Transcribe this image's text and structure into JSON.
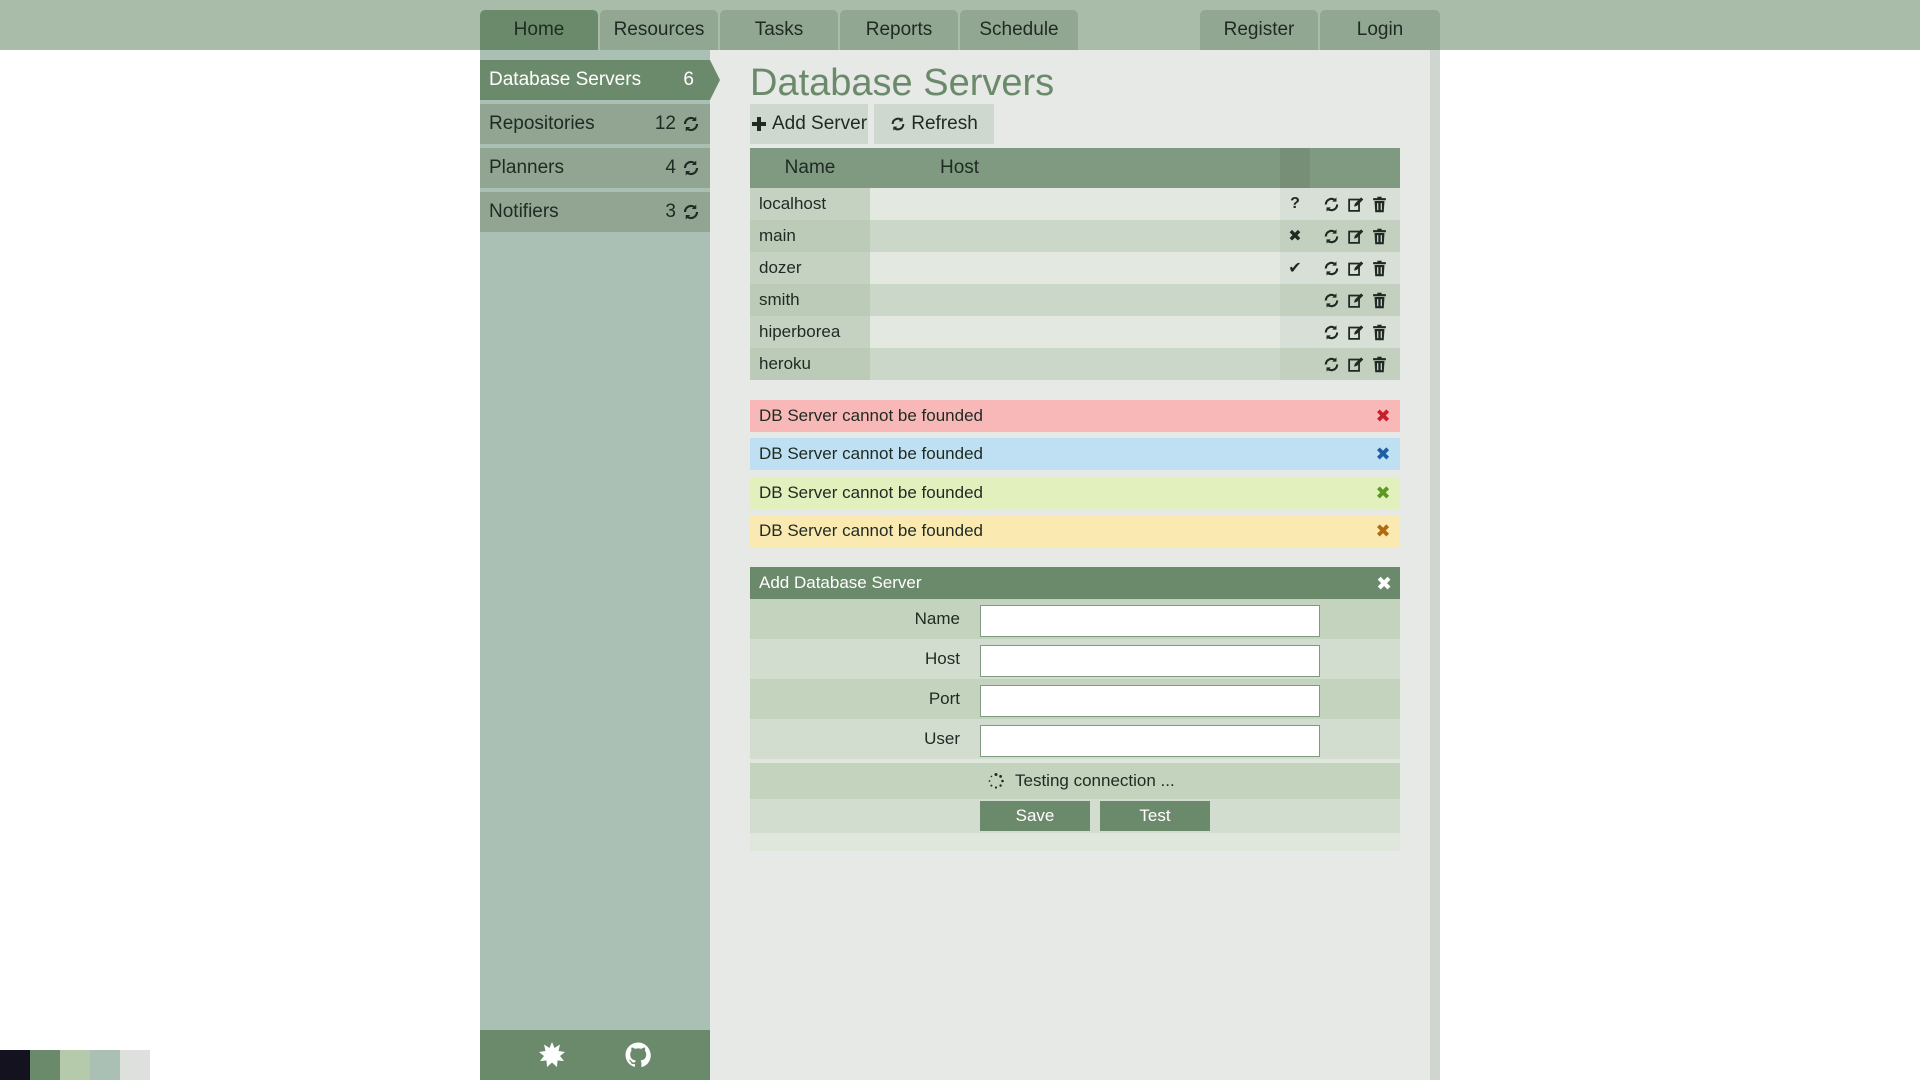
{
  "nav": {
    "tabs": [
      {
        "label": "Home"
      },
      {
        "label": "Resources"
      },
      {
        "label": "Tasks"
      },
      {
        "label": "Reports"
      },
      {
        "label": "Schedule"
      }
    ],
    "register": "Register",
    "login": "Login"
  },
  "sidebar": {
    "items": [
      {
        "label": "Database Servers",
        "count": "6"
      },
      {
        "label": "Repositories",
        "count": "12"
      },
      {
        "label": "Planners",
        "count": "4"
      },
      {
        "label": "Notifiers",
        "count": "3"
      }
    ],
    "footer_icons": [
      "settings-burst-icon",
      "github-icon"
    ]
  },
  "main": {
    "title": "Database Servers",
    "toolbar": {
      "add_label": "Add Server",
      "refresh_label": "Refresh"
    },
    "table": {
      "headers": {
        "name": "Name",
        "host": "Host"
      },
      "rows": [
        {
          "name": "localhost",
          "host": "",
          "status": "?"
        },
        {
          "name": "main",
          "host": "",
          "status": "✖"
        },
        {
          "name": "dozer",
          "host": "",
          "status": "✔"
        },
        {
          "name": "smith",
          "host": "",
          "status": ""
        },
        {
          "name": "hiperborea",
          "host": "",
          "status": ""
        },
        {
          "name": "heroku",
          "host": "",
          "status": ""
        }
      ]
    },
    "alerts": [
      {
        "text": "DB Server cannot be founded",
        "bg": "#f9b8b8",
        "icon_color": "#c8202a"
      },
      {
        "text": "DB Server cannot be founded",
        "bg": "#bfe0f2",
        "icon_color": "#1c5fa8"
      },
      {
        "text": "DB Server cannot be founded",
        "bg": "#e1f0bd",
        "icon_color": "#5a9a20"
      },
      {
        "text": "DB Server cannot be founded",
        "bg": "#fbe9b2",
        "icon_color": "#b06a10"
      }
    ],
    "form": {
      "title": "Add Database Server",
      "fields": [
        {
          "label": "Name",
          "value": ""
        },
        {
          "label": "Host",
          "value": ""
        },
        {
          "label": "Port",
          "value": ""
        },
        {
          "label": "User",
          "value": ""
        }
      ],
      "status": "Testing connection ...",
      "save_label": "Save",
      "test_label": "Test"
    }
  },
  "palette": [
    "#14121f",
    "#6b8a6b",
    "#b5c9ab",
    "#abc0b5",
    "#dde0dd"
  ],
  "colors": {
    "accent": "#6b8a6b",
    "topbar": "#a9bba9",
    "sidebar": "#abc0b5"
  }
}
